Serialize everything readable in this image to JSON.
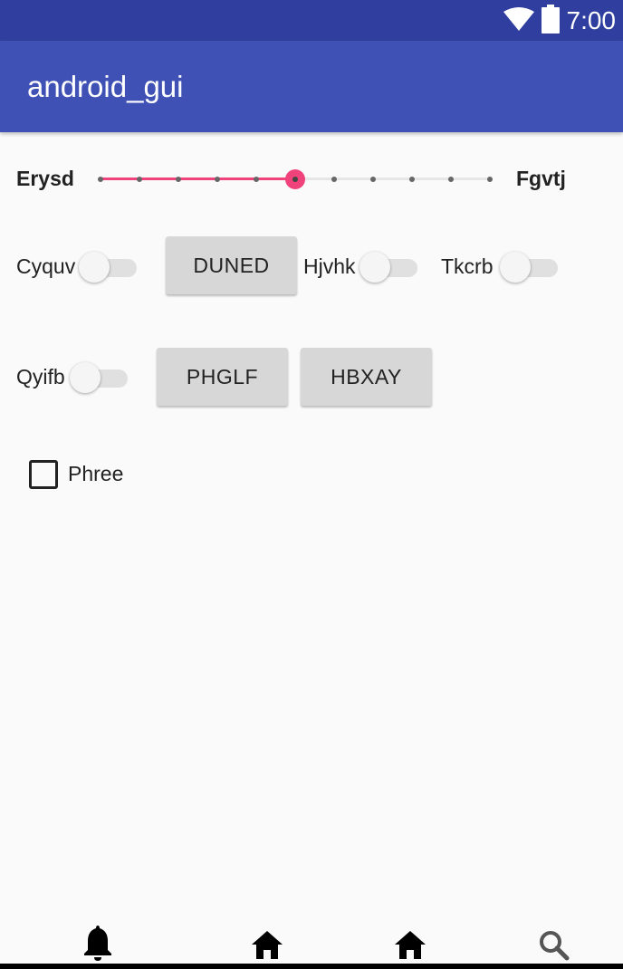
{
  "status_bar": {
    "time": "7:00",
    "icons": [
      "wifi-icon",
      "battery-icon"
    ]
  },
  "app_bar": {
    "title": "android_gui"
  },
  "seekbar": {
    "left_label": "Erysd",
    "right_label": "Fgvtj",
    "value": 5,
    "max": 10,
    "accent_color": "#f0437c"
  },
  "row1": {
    "switch1_label": "Cyquv",
    "button_label": "DUNED",
    "switch2_label": "Hjvhk",
    "switch3_label": "Tkcrb"
  },
  "row2": {
    "switch_label": "Qyifb",
    "button1_label": "PHGLF",
    "button2_label": "HBXAY"
  },
  "checkbox": {
    "label": "Phree",
    "checked": false
  },
  "bottom_nav": {
    "items": [
      "bell-icon",
      "home-icon",
      "home-icon",
      "search-icon"
    ]
  },
  "colors": {
    "primary": "#3f51b5",
    "primary_dark": "#303f9f",
    "accent": "#f0437c"
  }
}
